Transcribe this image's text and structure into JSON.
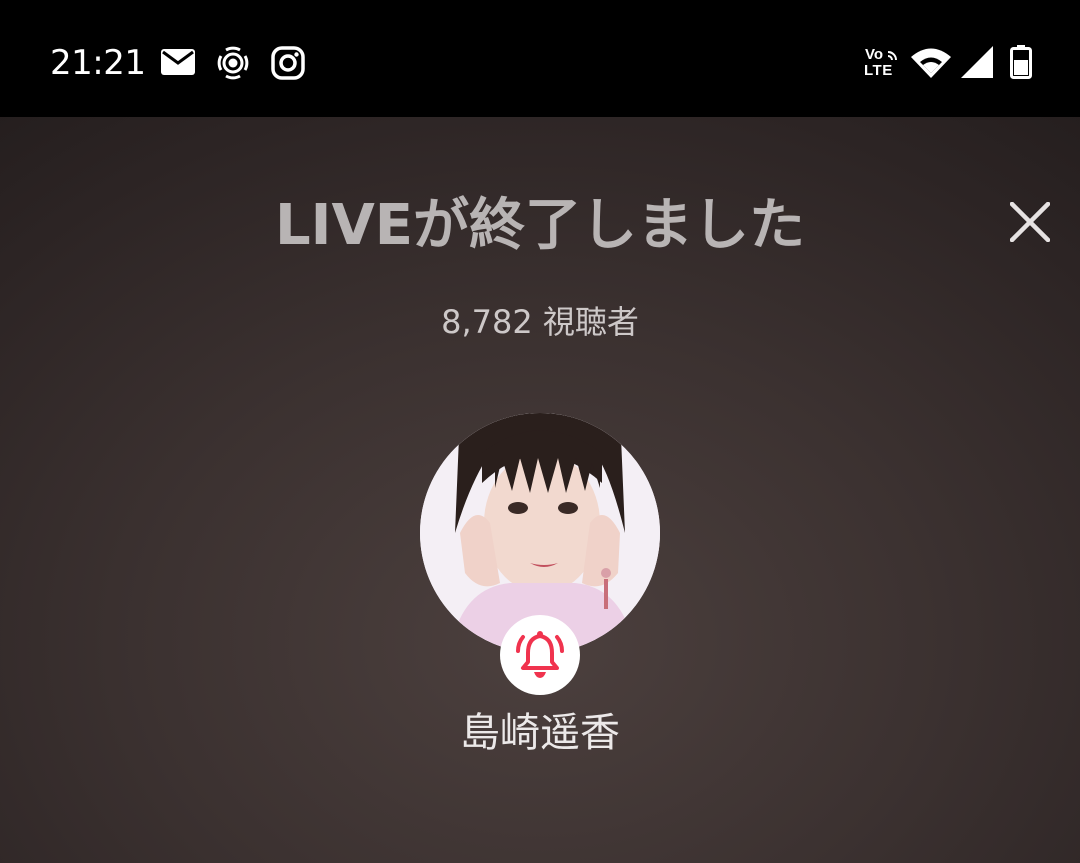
{
  "status_bar": {
    "time": "21:21",
    "left_icons": [
      "mail-icon",
      "broadcast-icon",
      "instagram-icon"
    ],
    "right_icons": [
      "volte-icon",
      "wifi-icon",
      "cell-signal-icon",
      "battery-icon"
    ],
    "volte_top": "Vo",
    "volte_bottom": "LTE"
  },
  "live_end": {
    "title": "LIVEが終了しました",
    "viewer_count": "8,782",
    "viewer_label": "視聴者",
    "viewers_text": "8,782 視聴者",
    "close_icon": "close-icon",
    "host_name": "島崎遥香",
    "follow_icon": "bell-icon"
  },
  "colors": {
    "status_bar_bg": "#000000",
    "background": "#3b3130",
    "title_text": "#b8b4b4",
    "bell_accent": "#f0334e",
    "username_text": "#ece9e9"
  }
}
